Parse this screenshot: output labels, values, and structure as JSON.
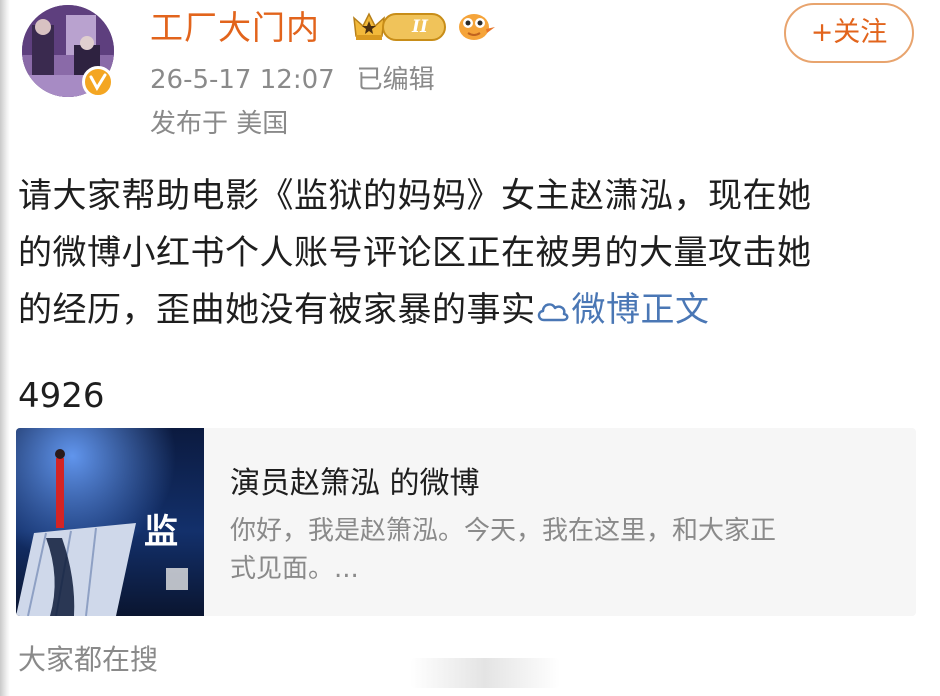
{
  "header": {
    "username": "工厂大门内",
    "level": "II",
    "follow_label": "+关注",
    "timestamp": "26-5-17 12:07",
    "edited": "已编辑",
    "location": "发布于 美国"
  },
  "post": {
    "lines": [
      "请大家帮助电影《监狱的妈妈》女主赵潇泓，现在她",
      "的微博小红书个人账号评论区正在被男的大量攻击她",
      "的经历，歪曲她没有被家暴的事实"
    ],
    "link_text": "微博正文",
    "count": "4926"
  },
  "card": {
    "title": "演员赵箫泓 的微博",
    "desc_lines": [
      "你好，我是赵箫泓。今天，我在这里，和大家正",
      "式见面。..."
    ],
    "thumb_text": "监"
  },
  "footer": {
    "search_label": "大家都在搜"
  },
  "colors": {
    "accent": "#e2641c",
    "link": "#4a77b5",
    "muted": "#8a8a8a"
  }
}
